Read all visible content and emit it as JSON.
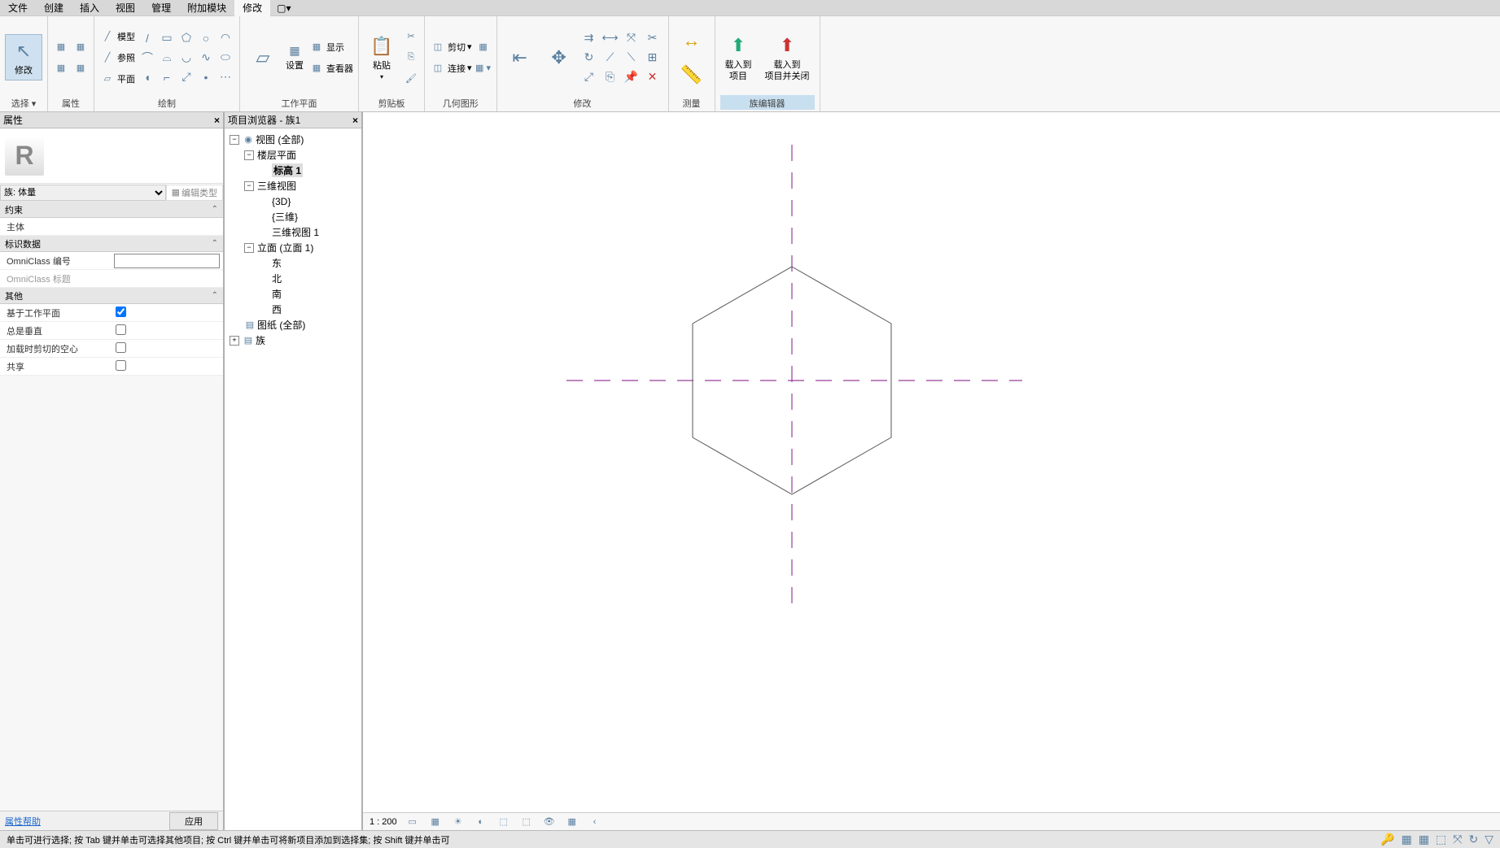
{
  "menu": [
    "文件",
    "创建",
    "插入",
    "视图",
    "管理",
    "附加模块",
    "修改"
  ],
  "menu_active_index": 6,
  "ribbon": {
    "select": {
      "modify": "修改",
      "label": "选择"
    },
    "props_label": "属性",
    "draw": {
      "model": "模型",
      "ref": "参照",
      "plane": "平面",
      "label": "绘制"
    },
    "workplane": {
      "set": "设置",
      "show": "显示",
      "viewer": "查看器",
      "label": "工作平面"
    },
    "clipboard": {
      "paste": "粘贴",
      "label": "剪贴板"
    },
    "geometry": {
      "cut": "剪切",
      "join": "连接",
      "label": "几何图形"
    },
    "modify": {
      "label": "修改"
    },
    "measure": {
      "label": "测量"
    },
    "family": {
      "load": "载入到\n项目",
      "load_close": "载入到\n项目并关闭",
      "label": "族编辑器"
    }
  },
  "props": {
    "title": "属性",
    "type_selector": "族: 体量",
    "edit_type": "编辑类型",
    "sections": {
      "constraints": "约束",
      "host": "主体",
      "identity": "标识数据",
      "omni_num": "OmniClass 编号",
      "omni_title": "OmniClass 标题",
      "other": "其他",
      "workplane_based": "基于工作平面",
      "always_vertical": "总是垂直",
      "load_cut_void": "加载时剪切的空心",
      "shared": "共享"
    },
    "help": "属性帮助",
    "apply": "应用"
  },
  "browser": {
    "title": "项目浏览器 - 族1",
    "views": "视图 (全部)",
    "floor_plans": "楼层平面",
    "level1": "标高 1",
    "three_d": "三维视图",
    "v_3d": "{3D}",
    "v_3d_zh": "{三维}",
    "v_3d_1": "三维视图 1",
    "elevations": "立面 (立面 1)",
    "east": "东",
    "north": "北",
    "south": "南",
    "west": "西",
    "sheets": "图纸 (全部)",
    "families": "族"
  },
  "view_controls": {
    "scale": "1 : 200"
  },
  "status": {
    "hint": "单击可进行选择; 按 Tab 键并单击可选择其他项目; 按 Ctrl 键并单击可将新项目添加到选择集; 按 Shift 键并单击可"
  }
}
